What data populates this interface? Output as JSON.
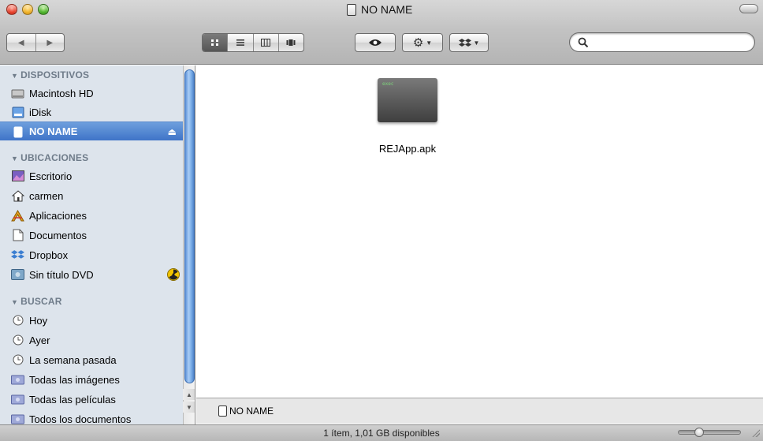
{
  "window": {
    "title": "NO NAME"
  },
  "toolbar": {
    "back_icon": "back-arrow-icon",
    "forward_icon": "forward-arrow-icon",
    "views": [
      "icon-view-icon",
      "list-view-icon",
      "column-view-icon",
      "coverflow-view-icon"
    ],
    "quicklook_icon": "eye-icon",
    "action_icon": "gear-icon",
    "dropbox_icon": "dropbox-icon",
    "search": {
      "value": "",
      "placeholder": ""
    }
  },
  "sidebar": {
    "sections": [
      {
        "label": "DISPOSITIVOS",
        "items": [
          {
            "label": "Macintosh HD",
            "icon": "hard-drive-icon"
          },
          {
            "label": "iDisk",
            "icon": "idisk-icon"
          },
          {
            "label": "NO NAME",
            "icon": "usb-drive-icon",
            "selected": true
          }
        ]
      },
      {
        "label": "UBICACIONES",
        "items": [
          {
            "label": "Escritorio",
            "icon": "desktop-icon"
          },
          {
            "label": "carmen",
            "icon": "home-icon"
          },
          {
            "label": "Aplicaciones",
            "icon": "applications-icon"
          },
          {
            "label": "Documentos",
            "icon": "documents-icon"
          },
          {
            "label": "Dropbox",
            "icon": "dropbox-icon"
          },
          {
            "label": "Sin título DVD",
            "icon": "dvd-icon"
          }
        ]
      },
      {
        "label": "BUSCAR",
        "items": [
          {
            "label": "Hoy",
            "icon": "clock-icon"
          },
          {
            "label": "Ayer",
            "icon": "clock-icon"
          },
          {
            "label": "La semana pasada",
            "icon": "clock-icon"
          },
          {
            "label": "Todas las imágenes",
            "icon": "smart-folder-icon"
          },
          {
            "label": "Todas las películas",
            "icon": "smart-folder-icon"
          },
          {
            "label": "Todos los documentos",
            "icon": "smart-folder-icon"
          }
        ]
      }
    ]
  },
  "content": {
    "files": [
      {
        "name": "REJApp.apk",
        "icon_tag": "exec"
      }
    ]
  },
  "pathbar": {
    "label": "NO NAME"
  },
  "status": {
    "text": "1 ítem, 1,01 GB disponibles"
  },
  "colors": {
    "selection": "#3f74c8",
    "sidebar_bg": "#dde4ec",
    "section_header": "#6f7c8a"
  }
}
